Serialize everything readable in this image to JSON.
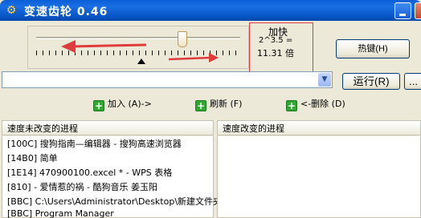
{
  "window": {
    "title": "变速齿轮 0.46",
    "icon": "gear-icon",
    "colors": {
      "titlebar": "#0a5fd8",
      "annotation": "#e03c3c"
    }
  },
  "speed_control": {
    "up_label": "加快",
    "formula": "2^3.5 =",
    "result": "11.31 倍"
  },
  "buttons": {
    "hotkey": "热键(H)",
    "run": "运行(R)",
    "more": "..."
  },
  "process_select": {
    "value": ""
  },
  "actions": {
    "add": "加入 (A)->",
    "refresh": "刷新 (F)",
    "delete": "<-删除 (D)"
  },
  "lists": {
    "unchanged_header": "速度未改变的进程",
    "changed_header": "速度改变的进程",
    "unchanged_items": [
      "[100C] 搜狗指南—编辑器 - 搜狗高速浏览器",
      "[14B0] 简单",
      "[1E14] 470900100.excel * - WPS 表格",
      "[810]  - 爱情惹的祸 - 酷狗音乐 姜玉阳",
      "[BBC] C:\\Users\\Administrator\\Desktop\\新建文件夹",
      "[BBC] Program Manager"
    ],
    "changed_items": []
  }
}
